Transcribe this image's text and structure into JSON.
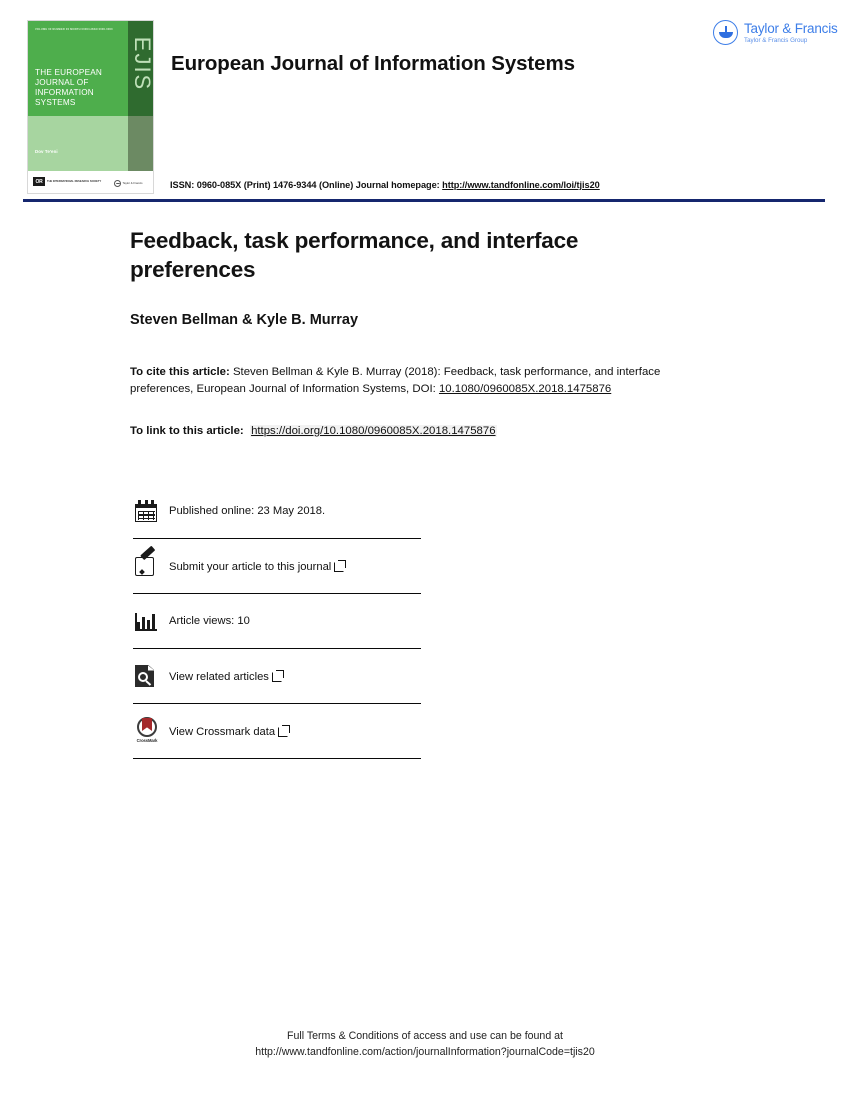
{
  "header": {
    "journal_title": "European Journal of Information Systems",
    "issn_text_prefix": "ISSN: 0960-085X (Print) 1476-9344 (Online) Journal homepage: ",
    "issn_homepage_url": "http://www.tandfonline.com/loi/tjis20",
    "publisher_logo": {
      "name_line1": "Taylor & Francis",
      "name_line2": "Taylor & Francis Group",
      "icon": "taylor-francis-roundel-icon",
      "color": "#3d7ee8"
    },
    "rule_color": "#15266e"
  },
  "cover": {
    "volume_line": "VOLUME 00 NUMBER 00 MONTH 0000\\nISSN 0000-0000",
    "title": "THE EUROPEAN JOURNAL OF INFORMATION SYSTEMS",
    "spine_text": "EJIS",
    "editor": "Dov Te'eni",
    "society_mark": "OR",
    "society_name": "THE\nINTERNATIONAL\nRESEARCH\nSOCIETY",
    "publisher_line1": "Taylor & Francis",
    "publisher_line2": "Taylor & Francis Group",
    "colors": {
      "green_main": "#4eae4c",
      "green_light": "#a7d5a0",
      "green_dark": "#2f6b2f",
      "green_olive": "#6c8a63"
    }
  },
  "article": {
    "title": "Feedback, task performance, and interface preferences",
    "authors": "Steven Bellman & Kyle B. Murray",
    "cite": {
      "label": "To cite this article:",
      "text": " Steven Bellman & Kyle B. Murray (2018): Feedback, task performance, and interface preferences, European Journal of Information Systems, DOI: ",
      "doi": "10.1080/0960085X.2018.1475876"
    },
    "link": {
      "label": "To link to this article:",
      "url": "https://doi.org/10.1080/0960085X.2018.1475876"
    }
  },
  "meta_rows": [
    {
      "icon": "calendar-icon",
      "label": "Published online: 23 May 2018.",
      "external": false
    },
    {
      "icon": "pencil-square-icon",
      "label": "Submit your article to this journal",
      "external": true
    },
    {
      "icon": "bar-chart-icon",
      "label": "Article views: 10",
      "external": false
    },
    {
      "icon": "document-search-icon",
      "label": "View related articles",
      "external": true
    },
    {
      "icon": "crossmark-icon",
      "label": "View Crossmark data",
      "external": true
    }
  ],
  "footer": {
    "line1": "Full Terms & Conditions of access and use can be found at",
    "line2": "http://www.tandfonline.com/action/journalInformation?journalCode=tjis20"
  }
}
